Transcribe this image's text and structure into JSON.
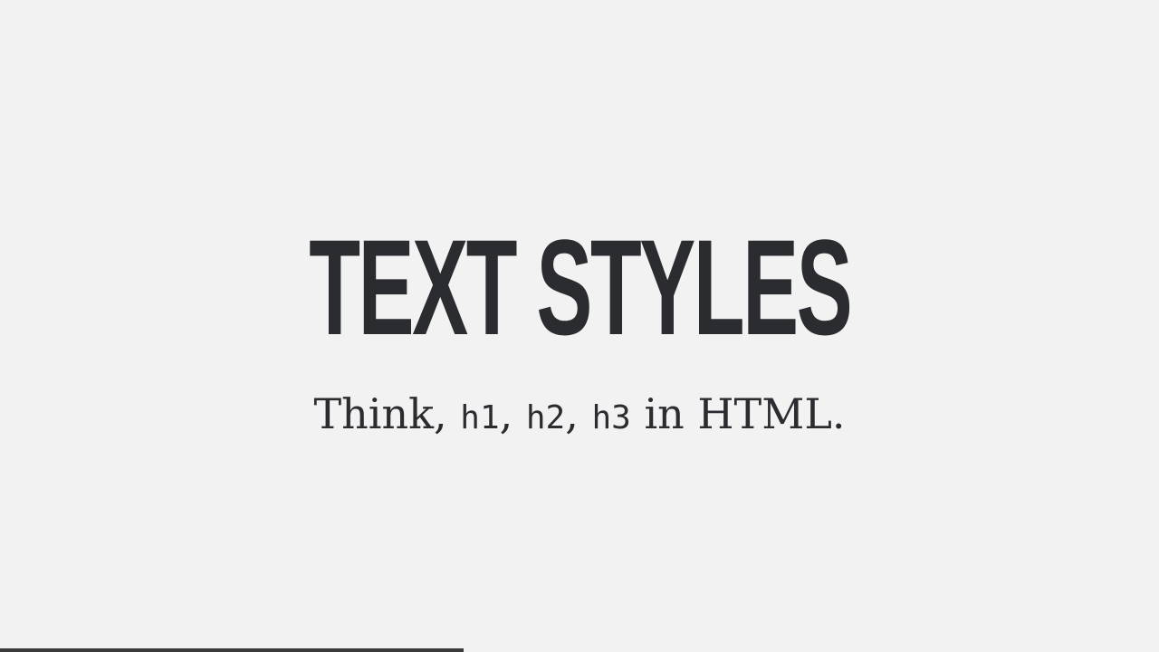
{
  "slide": {
    "title": "TEXT STYLES",
    "subtitle": {
      "prefix": "Think, ",
      "code1": "h1",
      "sep1": ", ",
      "code2": "h2",
      "sep2": ", ",
      "code3": "h3",
      "suffix": " in HTML."
    }
  },
  "progress": {
    "fraction": 0.4
  },
  "colors": {
    "background": "#f2f2f2",
    "text": "#2b2c2f",
    "progress": "#3a3a3a"
  }
}
